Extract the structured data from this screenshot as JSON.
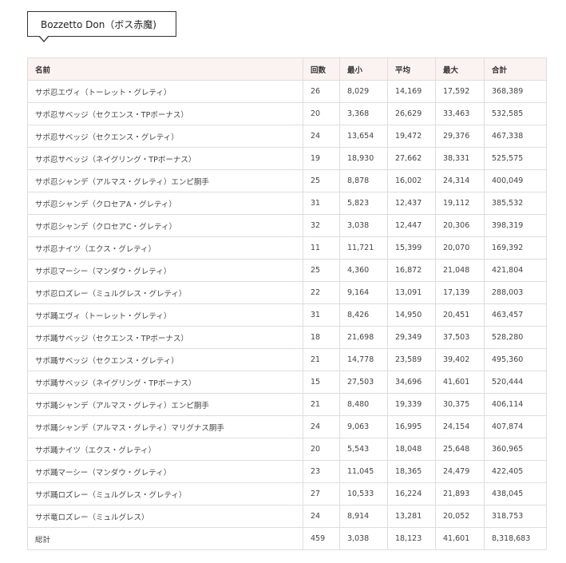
{
  "title": "Bozzetto Don（ボス赤魔)",
  "table": {
    "headers": [
      "名前",
      "回数",
      "最小",
      "平均",
      "最大",
      "合計"
    ],
    "rows": [
      [
        "サポ忍エヴィ（トーレット・グレティ）",
        "26",
        "8,029",
        "14,169",
        "17,592",
        "368,389"
      ],
      [
        "サポ忍サベッジ（セクエンス・TPボーナス）",
        "20",
        "3,368",
        "26,629",
        "33,463",
        "532,585"
      ],
      [
        "サポ忍サベッジ（セクエンス・グレティ）",
        "24",
        "13,654",
        "19,472",
        "29,376",
        "467,338"
      ],
      [
        "サポ忍サベッジ（ネイグリング・TPボーナス）",
        "19",
        "18,930",
        "27,662",
        "38,331",
        "525,575"
      ],
      [
        "サポ忍シャンデ（アルマス・グレティ）エンピ胴手",
        "25",
        "8,878",
        "16,002",
        "24,314",
        "400,049"
      ],
      [
        "サポ忍シャンデ（クロセアA・グレティ）",
        "31",
        "5,823",
        "12,437",
        "19,112",
        "385,532"
      ],
      [
        "サポ忍シャンデ（クロセアC・グレティ）",
        "32",
        "3,038",
        "12,447",
        "20,306",
        "398,319"
      ],
      [
        "サポ忍ナイツ（エクス・グレティ）",
        "11",
        "11,721",
        "15,399",
        "20,070",
        "169,392"
      ],
      [
        "サポ忍マーシー（マンダウ・グレティ）",
        "25",
        "4,360",
        "16,872",
        "21,048",
        "421,804"
      ],
      [
        "サポ忍ロズレー（ミュルグレス・グレティ）",
        "22",
        "9,164",
        "13,091",
        "17,139",
        "288,003"
      ],
      [
        "サポ踊エヴィ（トーレット・グレティ）",
        "31",
        "8,426",
        "14,950",
        "20,451",
        "463,457"
      ],
      [
        "サポ踊サベッジ（セクエンス・TPボーナス）",
        "18",
        "21,698",
        "29,349",
        "37,503",
        "528,280"
      ],
      [
        "サポ踊サベッジ（セクエンス・グレティ）",
        "21",
        "14,778",
        "23,589",
        "39,402",
        "495,360"
      ],
      [
        "サポ踊サベッジ（ネイグリング・TPボーナス）",
        "15",
        "27,503",
        "34,696",
        "41,601",
        "520,444"
      ],
      [
        "サポ踊シャンデ（アルマス・グレティ）エンピ胴手",
        "21",
        "8,480",
        "19,339",
        "30,375",
        "406,114"
      ],
      [
        "サポ踊シャンデ（アルマス・グレティ）マリグナス胴手",
        "24",
        "9,063",
        "16,995",
        "24,154",
        "407,874"
      ],
      [
        "サポ踊ナイツ（エクス・グレティ）",
        "20",
        "5,543",
        "18,048",
        "25,648",
        "360,965"
      ],
      [
        "サポ踊マーシー（マンダウ・グレティ）",
        "23",
        "11,045",
        "18,365",
        "24,479",
        "422,405"
      ],
      [
        "サポ踊ロズレー（ミュルグレス・グレティ）",
        "27",
        "10,533",
        "16,224",
        "21,893",
        "438,045"
      ],
      [
        "サポ竜ロズレー（ミュルグレス）",
        "24",
        "8,914",
        "13,281",
        "20,052",
        "318,753"
      ],
      [
        "総計",
        "459",
        "3,038",
        "18,123",
        "41,601",
        "8,318,683"
      ]
    ]
  },
  "colors": {
    "header_bg": "#fbf3f1",
    "border": "#e2dcdc",
    "text": "#444444"
  }
}
